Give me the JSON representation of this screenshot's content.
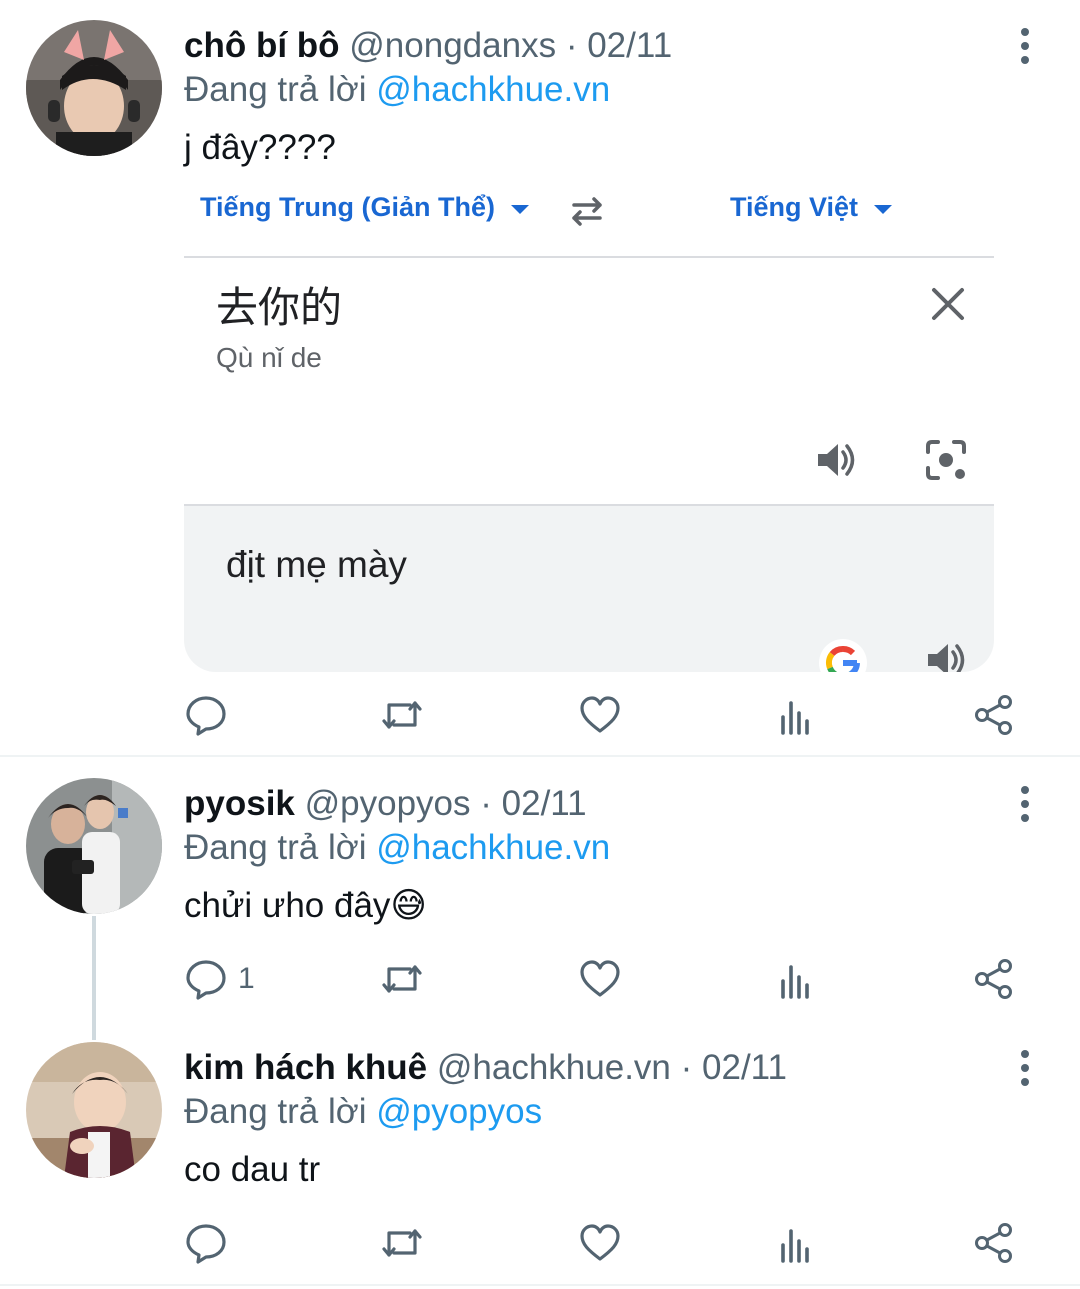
{
  "tweets": [
    {
      "name": "chô bí bô",
      "handle": "@nongdanxs",
      "separator": "·",
      "date": "02/11",
      "reply_prefix": "Đang trả lời",
      "reply_to": "@hachkhue.vn",
      "text": "j đây????",
      "reply_count": ""
    },
    {
      "name": "pyosik",
      "handle": "@pyopyos",
      "separator": "·",
      "date": "02/11",
      "reply_prefix": "Đang trả lời",
      "reply_to": "@hachkhue.vn",
      "text": "chửi ưho đây😅",
      "reply_count": "1"
    },
    {
      "name": "kim hách khuê",
      "handle": "@hachkhue.vn",
      "separator": "·",
      "date": "02/11",
      "reply_prefix": "Đang trả lời",
      "reply_to": "@pyopyos",
      "text": "co dau tr",
      "reply_count": ""
    }
  ],
  "translate": {
    "source_lang": "Tiếng Trung (Giản Thể)",
    "target_lang": "Tiếng Việt",
    "source_text": "去你的",
    "source_romanization": "Qù nǐ de",
    "translated_text": "địt mẹ mày"
  },
  "icons": {
    "reply": "reply-icon",
    "retweet": "retweet-icon",
    "like": "like-icon",
    "views": "views-icon",
    "share": "share-icon",
    "more": "more-icon"
  },
  "colors": {
    "mention": "#1d9bf0",
    "secondary_text": "#536471",
    "translate_blue": "#1967d2"
  }
}
